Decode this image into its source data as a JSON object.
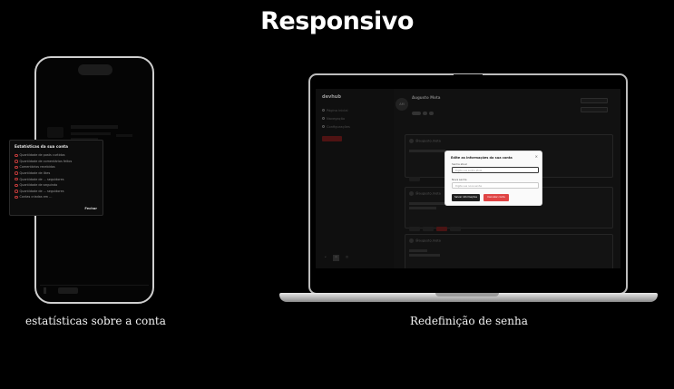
{
  "header": {
    "title": "Responsivo"
  },
  "mobile": {
    "caption": "estatísticas sobre a conta",
    "stats_modal": {
      "title": "Estatísticas da sua conta",
      "items": [
        "Quantidade de posts curtidos",
        "Quantidade de comentários feitos",
        "Comentários recebidos",
        "Quantidade de likes",
        "Quantidade de ... seguidores",
        "Quantidade de seguindo",
        "Quantidade de ... seguidores",
        "Contas criadas em ..."
      ],
      "close_label": "Fechar"
    }
  },
  "desktop": {
    "caption": "Redefinição de senha",
    "app": {
      "brand": "devhub",
      "nav": [
        "Página inicial",
        "Navegação",
        "Configurações"
      ],
      "user": {
        "initials": "AM",
        "name": "Augusto Mota"
      },
      "cards": [
        "@augusto.mota",
        "@augusto.mota",
        "@augusto.mota"
      ]
    },
    "password_modal": {
      "title": "Edite as informações da sua conta",
      "close_icon": "×",
      "label_current": "Senha atual",
      "placeholder_current": "Digite sua senha atual",
      "label_new": "Nova senha",
      "placeholder_new": "Digite sua nova senha",
      "save_label": "Salvar informações",
      "cancel_label": "Cancelar conta"
    }
  }
}
